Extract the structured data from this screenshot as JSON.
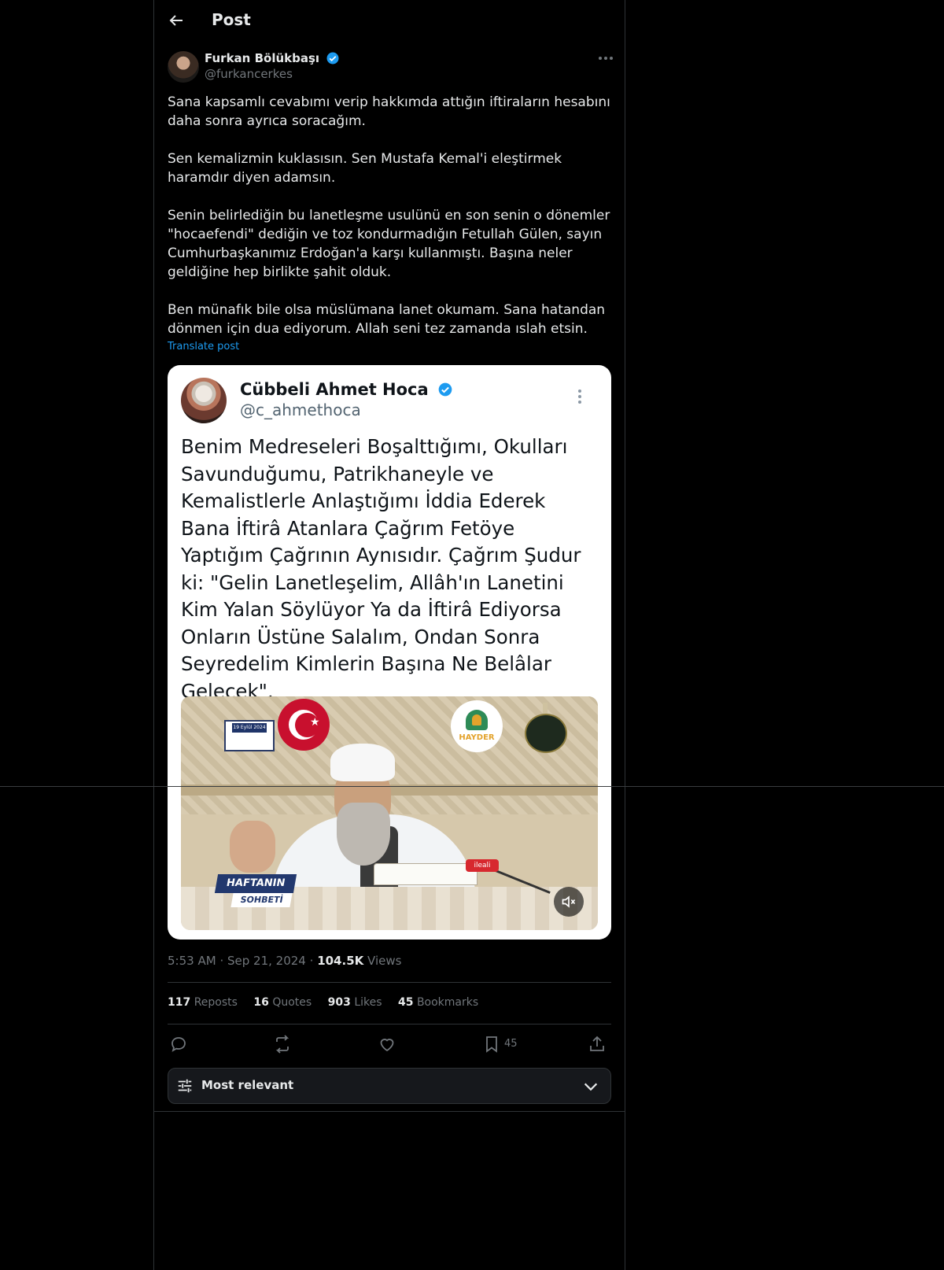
{
  "header": {
    "title": "Post"
  },
  "post": {
    "author_name": "Furkan Bölükbaşı",
    "author_handle": "@furkancerkes",
    "paragraphs": [
      "Sana kapsamlı cevabımı verip hakkımda attığın iftiraların hesabını daha sonra ayrıca soracağım.",
      "Sen kemalizmin kuklasısın. Sen Mustafa Kemal'i eleştirmek haramdır diyen adamsın.",
      "Senin belirlediğin bu lanetleşme usulünü en son senin o dönemler \"hocaefendi\" dediğin ve toz kondurmadığın Fetullah Gülen, sayın Cumhurbaşkanımız Erdoğan'a karşı kullanmıştı. Başına neler geldiğine hep birlikte şahit olduk.",
      "Ben münafık bile olsa müslümana lanet okumam. Sana hatandan dönmen için dua ediyorum. Allah seni tez zamanda ıslah etsin."
    ],
    "translate_label": "Translate post"
  },
  "quoted": {
    "name": "Cübbeli Ahmet Hoca",
    "handle": "@c_ahmethoca",
    "text": "Benim Medreseleri Boşalttığımı, Okulları Savunduğumu, Patrikhaneyle ve Kemalistlerle Anlaştığımı İddia Ederek Bana İftirâ Atanlara Çağrım Fetöye Yaptığım Çağrının Aynısıdır. Çağrım Şudur ki: \"Gelin Lanetleşelim, Allâh'ın Lanetini Kim Yalan Söylüyor Ya da İftirâ Ediyorsa Onların Üstüne Salalım, Ondan Sonra Seyredelim Kimlerin Başına Ne Belâlar Gelecek\".",
    "video": {
      "date_badge": "19 Eylül 2024",
      "logo_text": "HAYDER",
      "mic_text": "ileali",
      "banner_top": "HAFTANIN",
      "banner_bottom": "SOHBETİ"
    }
  },
  "meta": {
    "time": "5:53 AM",
    "sep": "·",
    "date": "Sep 21, 2024",
    "views_count": "104.5K",
    "views_label": "Views"
  },
  "stats": [
    {
      "count": "117",
      "label": "Reposts"
    },
    {
      "count": "16",
      "label": "Quotes"
    },
    {
      "count": "903",
      "label": "Likes"
    },
    {
      "count": "45",
      "label": "Bookmarks"
    }
  ],
  "actions": {
    "icons": [
      "reply-icon",
      "repost-icon",
      "like-icon",
      "bookmark-icon",
      "share-icon"
    ],
    "bookmark_count": "45"
  },
  "sort": {
    "label": "Most relevant"
  },
  "colors": {
    "accent": "#1d9bf0",
    "background": "#000000",
    "muted": "#71767b",
    "border": "#2f3336"
  }
}
